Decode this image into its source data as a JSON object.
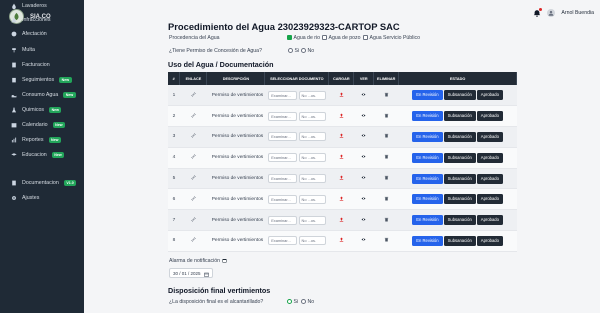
{
  "brand": {
    "name": "SIA.CO"
  },
  "sidebar": {
    "items": [
      {
        "label": "Lavaderos",
        "icon": "droplet-icon",
        "badge": ""
      },
      {
        "label": "Infracciones",
        "icon": "warning-icon",
        "badge": ""
      },
      {
        "label": "Afectación",
        "icon": "alert-icon",
        "badge": ""
      },
      {
        "label": "Multa",
        "icon": "gavel-icon",
        "badge": ""
      },
      {
        "label": "Facturacion",
        "icon": "receipt-icon",
        "badge": ""
      },
      {
        "label": "Seguimientos",
        "icon": "clipboard-icon",
        "badge": "New"
      },
      {
        "label": "Consumo Agua",
        "icon": "water-icon",
        "badge": "New"
      },
      {
        "label": "Quimicos",
        "icon": "flask-icon",
        "badge": "New"
      },
      {
        "label": "Calendario",
        "icon": "calendar-icon",
        "badge": "New"
      },
      {
        "label": "Reportes",
        "icon": "chart-icon",
        "badge": "New"
      },
      {
        "label": "Educacion",
        "icon": "graduation-icon",
        "badge": "New"
      },
      {
        "label": "Documentacion",
        "icon": "document-icon",
        "badge": "V1.0"
      },
      {
        "label": "Ajustes",
        "icon": "gear-icon",
        "badge": ""
      }
    ]
  },
  "user": {
    "name": "Arnol Buendia"
  },
  "page": {
    "title": "Procedimiento del Agua 23023929323-CARTOP SAC"
  },
  "procedencia": {
    "label": "Procedencia del Agua",
    "options": [
      {
        "label": "Agua de rio",
        "checked": true
      },
      {
        "label": "Agua de pozo",
        "checked": false
      },
      {
        "label": "Agua Servicio Público",
        "checked": false
      }
    ]
  },
  "permiso": {
    "question": "¿Tiene Permiso de Concesión de Agua?",
    "options": [
      {
        "label": "Si",
        "selected": false
      },
      {
        "label": "No",
        "selected": false
      }
    ]
  },
  "uso": {
    "title": "Uso del Agua / Documentación"
  },
  "table": {
    "headers": [
      "#",
      "ENLACE",
      "DESCRIPCIÓN",
      "SELECCIONAR DOCUMENTO",
      "CARGAR",
      "VER",
      "ELIMINAR",
      "ESTADO"
    ],
    "rows": [
      {
        "num": "1",
        "description": "Permiso de vertimientos"
      },
      {
        "num": "2",
        "description": "Permiso de vertimientos"
      },
      {
        "num": "3",
        "description": "Permiso de vertimientos"
      },
      {
        "num": "4",
        "description": "Permiso de vertimientos"
      },
      {
        "num": "5",
        "description": "Permiso de vertimientos"
      },
      {
        "num": "6",
        "description": "Permiso de vertimientos"
      },
      {
        "num": "7",
        "description": "Permiso de vertimientos"
      },
      {
        "num": "8",
        "description": "Permiso de vertimientos"
      }
    ],
    "file_placeholder": "Examinar...",
    "file_status": "No ...os.",
    "status_buttons": [
      "En Revisión",
      "Subsanación",
      "Aprobado"
    ],
    "accent": "#2563eb",
    "dark": "#222b36"
  },
  "alarma": {
    "label": "Alarma de notificación",
    "date": "30 / 01 / 2025"
  },
  "disposicion": {
    "title": "Disposición final vertimientos",
    "question": "¿La disposición final es el alcantarillado?",
    "options": [
      {
        "label": "Si",
        "selected": true
      },
      {
        "label": "No",
        "selected": false
      }
    ]
  }
}
